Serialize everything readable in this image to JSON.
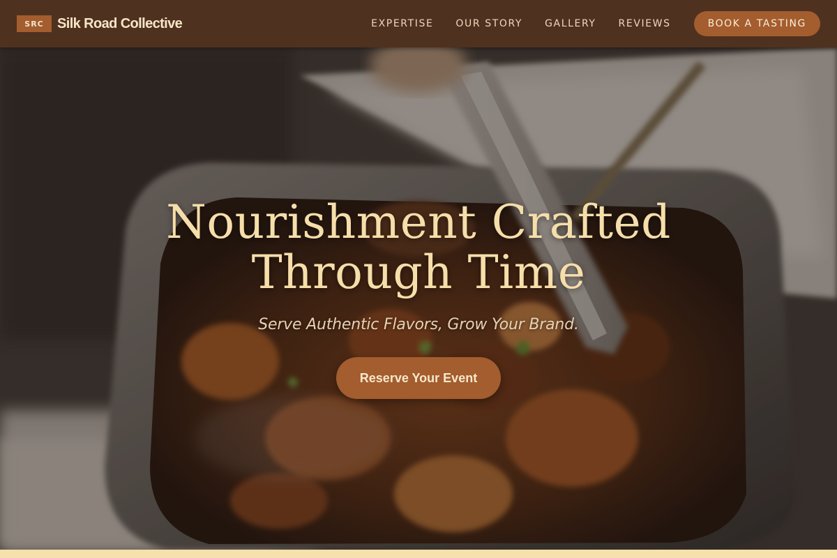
{
  "nav": {
    "badge": "SRC",
    "brand": "Silk Road Collective",
    "links": [
      "EXPERTISE",
      "OUR STORY",
      "GALLERY",
      "REVIEWS"
    ],
    "cta": "BOOK A TASTING"
  },
  "hero": {
    "title_line1": "Nourishment Crafted",
    "title_line2": "Through Time",
    "subtitle": "Serve Authentic Flavors, Grow Your Brand.",
    "cta": "Reserve Your Event"
  },
  "colors": {
    "nav_bg": "#4f3120",
    "accent": "#a35d2e",
    "title": "#f6deaa",
    "strip": "#f6e0ab"
  },
  "icons": {
    "hero_image": "catering-food-tray-photo"
  }
}
